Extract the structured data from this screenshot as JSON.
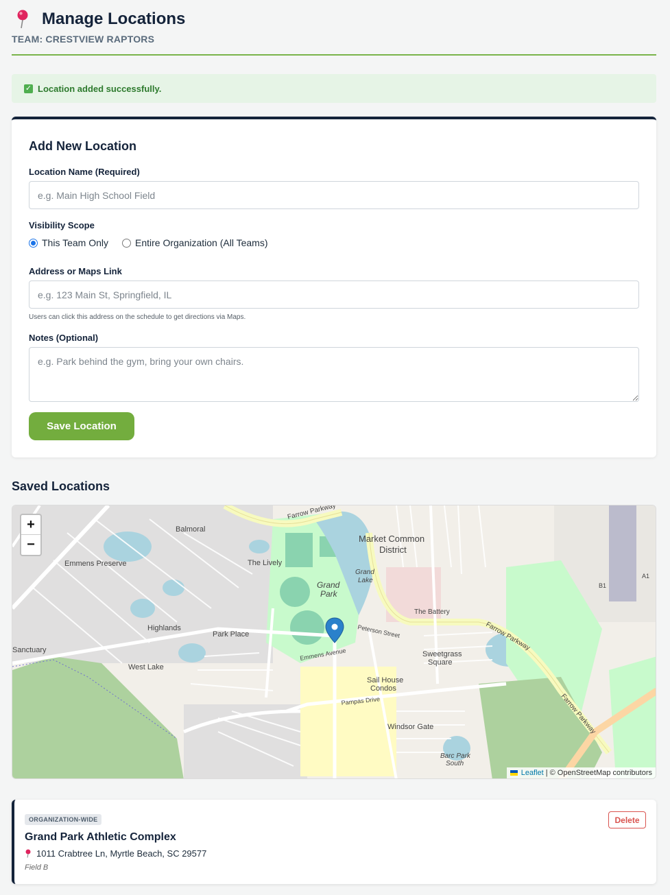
{
  "header": {
    "title": "Manage Locations",
    "team": "TEAM: CRESTVIEW RAPTORS",
    "icon": "pushpin-icon"
  },
  "alert": {
    "message": "Location added successfully.",
    "icon": "checkbox-icon",
    "color": "#2d7a2d"
  },
  "form": {
    "heading": "Add New Location",
    "name_label": "Location Name (Required)",
    "name_placeholder": "e.g. Main High School Field",
    "name_value": "",
    "scope_label": "Visibility Scope",
    "scope_options": [
      {
        "label": "This Team Only",
        "selected": true
      },
      {
        "label": "Entire Organization (All Teams)",
        "selected": false
      }
    ],
    "address_label": "Address or Maps Link",
    "address_placeholder": "e.g. 123 Main St, Springfield, IL",
    "address_value": "",
    "address_hint": "Users can click this address on the schedule to get directions via Maps.",
    "notes_label": "Notes (Optional)",
    "notes_placeholder": "e.g. Park behind the gym, bring your own chairs.",
    "notes_value": "",
    "save_label": "Save Location",
    "accent": "#73ad3e"
  },
  "saved": {
    "title": "Saved Locations",
    "map": {
      "zoom_in": "+",
      "zoom_out": "−",
      "attribution_leaflet": "Leaflet",
      "attribution_osm": "| © OpenStreetMap contributors",
      "labels": {
        "farrow_parkway": "Farrow Parkway",
        "market_common": "Market Common",
        "district": "District",
        "grand_park_1": "Grand",
        "grand_park_2": "Park",
        "grand_lake": "Grand Lake",
        "the_battery": "The Battery",
        "sweetgrass": "Sweetgrass",
        "square": "Square",
        "sail_house": "Sail House",
        "condos": "Condos",
        "windsor_gate": "Windsor Gate",
        "barc_park": "Barc Park",
        "south": "South",
        "emmens_preserve": "Emmens Preserve",
        "balmoral": "Balmoral",
        "the_lively": "The Lively",
        "highlands": "Highlands",
        "park_place": "Park Place",
        "west_lake": "West Lake",
        "sanctuary": "Sanctuary",
        "emmens_avenue": "Emmens Avenue",
        "pampas_drive": "Pampas Drive",
        "peterson_street": "Peterson Street",
        "farrow_parkway_2": "Farrow Parkway"
      }
    },
    "locations": [
      {
        "badge": "ORGANIZATION-WIDE",
        "name": "Grand Park Athletic Complex",
        "address": "1011 Crabtree Ln, Myrtle Beach, SC 29577",
        "notes": "Field B",
        "delete_label": "Delete"
      }
    ]
  }
}
